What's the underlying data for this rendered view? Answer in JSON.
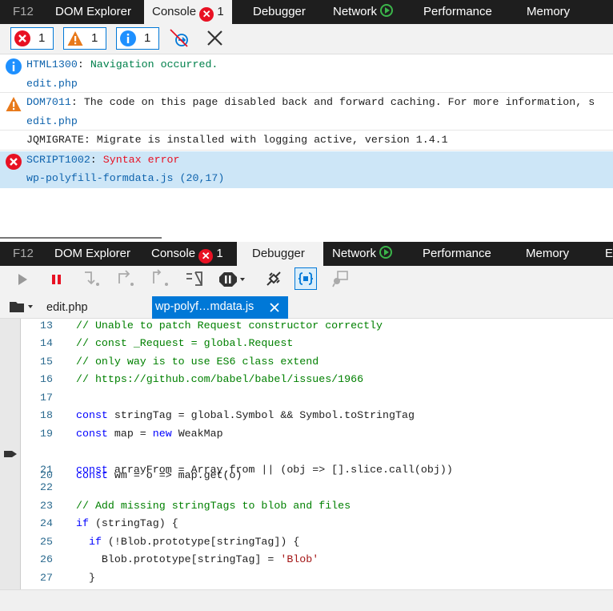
{
  "console_tabs": [
    {
      "label": "F12"
    },
    {
      "label": "DOM Explorer"
    },
    {
      "label": "Console",
      "error_count": "1"
    },
    {
      "label": "Debugger"
    },
    {
      "label": "Network"
    },
    {
      "label": "Performance"
    },
    {
      "label": "Memory"
    }
  ],
  "console_filters": {
    "errors": "1",
    "warnings": "1",
    "messages": "1"
  },
  "messages": [
    {
      "code": "HTML1300",
      "sep": ": ",
      "text": "Navigation occurred.",
      "source": "edit.php",
      "level": "info"
    },
    {
      "code": "DOM7011",
      "sep": ": ",
      "text": "The code on this page disabled back and forward caching. For more information, s",
      "source": "edit.php",
      "level": "warning"
    },
    {
      "text": "JQMIGRATE: Migrate is installed with logging active, version 1.4.1",
      "level": "log"
    },
    {
      "code": "SCRIPT1002",
      "sep": ": ",
      "text": "Syntax error",
      "source": "wp-polyfill-formdata.js (20,17)",
      "level": "error"
    }
  ],
  "debugger_tabs": [
    {
      "label": "F12"
    },
    {
      "label": "DOM Explorer"
    },
    {
      "label": "Console",
      "error_count": "1"
    },
    {
      "label": "Debugger"
    },
    {
      "label": "Network"
    },
    {
      "label": "Performance"
    },
    {
      "label": "Memory"
    },
    {
      "label": "E"
    }
  ],
  "file_tabs": [
    {
      "label": "edit.php"
    },
    {
      "label": "wp-polyf…mdata.js"
    }
  ],
  "code_lines": [
    {
      "num": "13",
      "text": "// Unable to patch Request constructor correctly"
    },
    {
      "num": "14",
      "text": "// const _Request = global.Request"
    },
    {
      "num": "15",
      "text": "// only way is to use ES6 class extend"
    },
    {
      "num": "16",
      "text": "// https://github.com/babel/babel/issues/1966"
    },
    {
      "num": "17",
      "text": ""
    },
    {
      "num": "18",
      "text": "const stringTag = global.Symbol && Symbol.toStringTag"
    },
    {
      "num": "19",
      "text": "const map = new WeakMap"
    },
    {
      "num": "20",
      "text": "const wm = o => map.get(o)"
    },
    {
      "num": "21",
      "text": "const arrayFrom = Array.from || (obj => [].slice.call(obj))"
    },
    {
      "num": "22",
      "text": ""
    },
    {
      "num": "23",
      "text": "// Add missing stringTags to blob and files"
    },
    {
      "num": "24",
      "text": "if (stringTag) {"
    },
    {
      "num": "25",
      "text": "  if (!Blob.prototype[stringTag]) {"
    },
    {
      "num": "26",
      "text": "    Blob.prototype[stringTag] = 'Blob'"
    },
    {
      "num": "27",
      "text": "  }"
    }
  ],
  "colors": {
    "accent": "#0078d7",
    "error": "#e81123",
    "warning": "#e8791a",
    "info": "#1e90ff",
    "selected_row": "#cde6f7"
  }
}
